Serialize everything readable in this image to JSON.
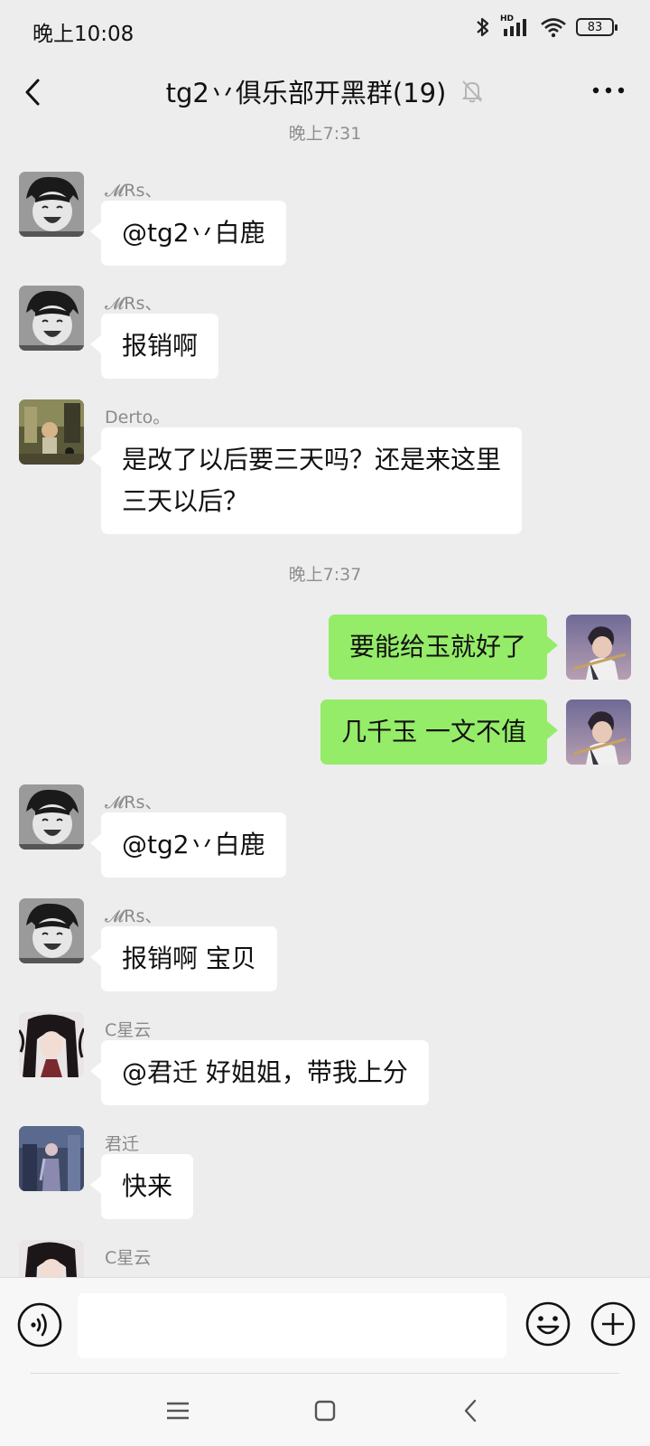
{
  "status_bar": {
    "time": "晚上10:08",
    "network_label": "HD",
    "battery": "83"
  },
  "header": {
    "title": "tg2丷俱乐部开黑群(19)",
    "back_icon": "chevron-left-icon",
    "mute_icon": "bell-off-icon",
    "more_icon": "more-dots-icon"
  },
  "timestamps": [
    "晚上7:31",
    "晚上7:37"
  ],
  "messages": [
    {
      "sender": "𝓜Rs、",
      "text": "@tg2丷白鹿",
      "side": "in"
    },
    {
      "sender": "𝓜Rs、",
      "text": "报销啊",
      "side": "in"
    },
    {
      "sender": "Derto。",
      "text_line1": "是改了以后要三天吗？还是来这里",
      "text_line2": "三天以后？",
      "side": "in"
    },
    {
      "text": "要能给玉就好了",
      "side": "out"
    },
    {
      "text": "几千玉 一文不值",
      "side": "out"
    },
    {
      "sender": "𝓜Rs、",
      "text": "@tg2丷白鹿",
      "side": "in"
    },
    {
      "sender": "𝓜Rs、",
      "text": "报销啊 宝贝",
      "side": "in"
    },
    {
      "sender": "C星云",
      "text": "@君迁  好姐姐，带我上分",
      "side": "in"
    },
    {
      "sender": "君迁",
      "text": "快来",
      "side": "in"
    },
    {
      "sender": "C星云",
      "side": "in"
    }
  ],
  "input_bar": {
    "placeholder": "",
    "voice_icon": "voice-icon",
    "emoji_icon": "emoji-icon",
    "plus_icon": "plus-icon"
  },
  "colors": {
    "background": "#ededed",
    "incoming_bubble": "#ffffff",
    "outgoing_bubble": "#95ec69",
    "timestamp": "#8e8e8e"
  }
}
